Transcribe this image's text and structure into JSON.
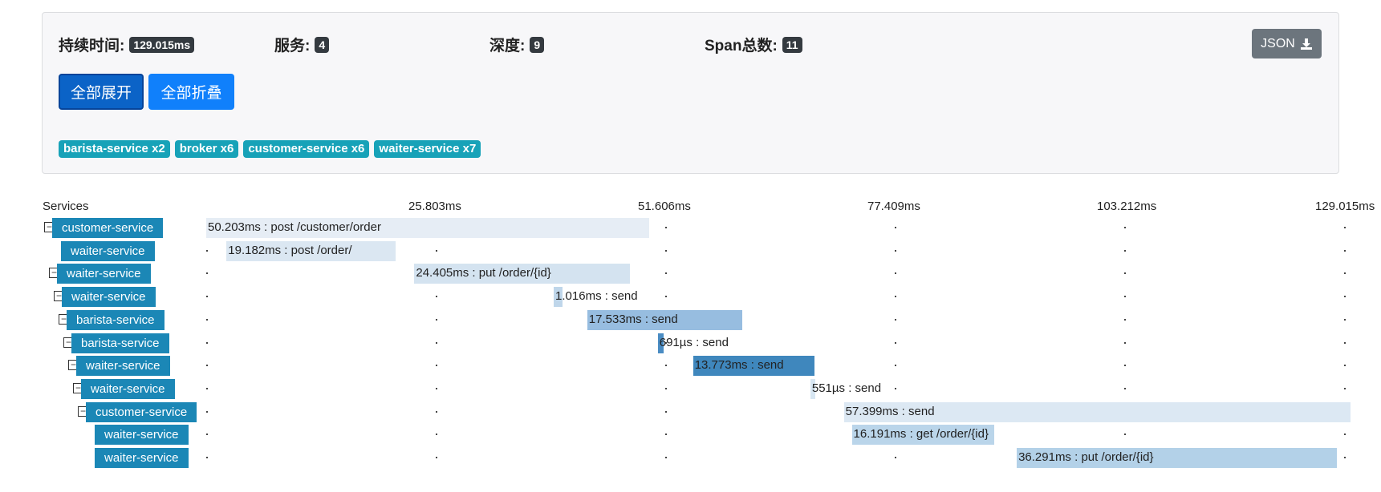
{
  "summary": {
    "duration_label": "持续时间:",
    "duration_value": "129.015ms",
    "services_label": "服务:",
    "services_value": "4",
    "depth_label": "深度:",
    "depth_value": "9",
    "spans_label": "Span总数:",
    "spans_value": "11",
    "json_button_label": "JSON",
    "expand_all_label": "全部展开",
    "collapse_all_label": "全部折叠",
    "service_tags": [
      "barista-service x2",
      "broker x6",
      "customer-service x6",
      "waiter-service x7"
    ]
  },
  "timeline": {
    "services_header": "Services",
    "total_ms": 129.015,
    "ticks": [
      "25.803ms",
      "51.606ms",
      "77.409ms",
      "103.212ms",
      "129.015ms"
    ],
    "spans": [
      {
        "service": "customer-service",
        "label": "50.203ms : post /customer/order",
        "start_ms": 0,
        "duration_ms": 50.203,
        "depth": 0,
        "collapsible": true,
        "color": "#e6edf5"
      },
      {
        "service": "waiter-service",
        "label": "19.182ms : post /order/",
        "start_ms": 2.3,
        "duration_ms": 19.182,
        "depth": 1,
        "collapsible": false,
        "color": "#dbe7f2"
      },
      {
        "service": "waiter-service",
        "label": "24.405ms : put /order/{id}",
        "start_ms": 23.6,
        "duration_ms": 24.405,
        "depth": 1,
        "collapsible": true,
        "color": "#d4e3f0"
      },
      {
        "service": "waiter-service",
        "label": "1.016ms : send",
        "start_ms": 39.4,
        "duration_ms": 1.016,
        "depth": 2,
        "collapsible": true,
        "color": "#bfd6ea"
      },
      {
        "service": "barista-service",
        "label": "17.533ms : send",
        "start_ms": 43.2,
        "duration_ms": 17.533,
        "depth": 3,
        "collapsible": true,
        "color": "#97bde0"
      },
      {
        "service": "barista-service",
        "label": "691µs : send",
        "start_ms": 51.2,
        "duration_ms": 0.691,
        "depth": 4,
        "collapsible": true,
        "color": "#4a8cc3"
      },
      {
        "service": "waiter-service",
        "label": "13.773ms : send",
        "start_ms": 55.2,
        "duration_ms": 13.773,
        "depth": 5,
        "collapsible": true,
        "color": "#3f87bd"
      },
      {
        "service": "waiter-service",
        "label": "551µs : send",
        "start_ms": 68.5,
        "duration_ms": 0.551,
        "depth": 6,
        "collapsible": true,
        "color": "#d7e6f2"
      },
      {
        "service": "customer-service",
        "label": "57.399ms : send",
        "start_ms": 72.3,
        "duration_ms": 57.399,
        "depth": 7,
        "collapsible": true,
        "color": "#dce8f3"
      },
      {
        "service": "waiter-service",
        "label": "16.191ms : get /order/{id}",
        "start_ms": 73.2,
        "duration_ms": 16.191,
        "depth": 8,
        "collapsible": false,
        "color": "#bad5ea"
      },
      {
        "service": "waiter-service",
        "label": "36.291ms : put /order/{id}",
        "start_ms": 91.9,
        "duration_ms": 36.291,
        "depth": 8,
        "collapsible": false,
        "color": "#b3d1e8"
      }
    ]
  }
}
